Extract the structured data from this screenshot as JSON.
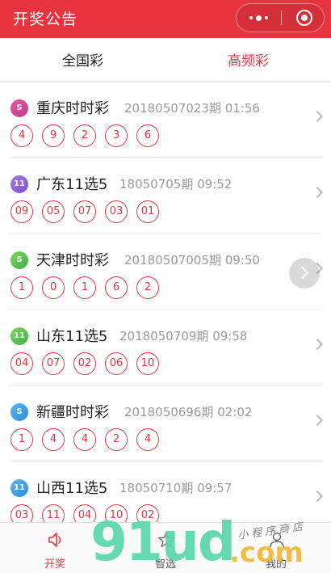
{
  "header": {
    "title": "开奖公告"
  },
  "tabs": [
    {
      "label": "全国彩",
      "active": false
    },
    {
      "label": "高频彩",
      "active": true
    }
  ],
  "lotteries": [
    {
      "name": "重庆时时彩",
      "issue": "20180507023期 01:56",
      "logo_icon": "ssc-logo-icon",
      "logo_text": "S",
      "logo_color": "pink",
      "numbers": [
        "4",
        "9",
        "2",
        "3",
        "6"
      ]
    },
    {
      "name": "广东11选5",
      "issue": "18050705期 09:52",
      "logo_icon": "11x5-logo-icon",
      "logo_text": "11",
      "logo_color": "purple",
      "numbers": [
        "09",
        "05",
        "07",
        "03",
        "01"
      ]
    },
    {
      "name": "天津时时彩",
      "issue": "20180507005期 09:50",
      "logo_icon": "ssc-logo-icon",
      "logo_text": "S",
      "logo_color": "green",
      "numbers": [
        "1",
        "0",
        "1",
        "6",
        "2"
      ]
    },
    {
      "name": "山东11选5",
      "issue": "2018050709期 09:58",
      "logo_icon": "11x5-logo-icon",
      "logo_text": "11",
      "logo_color": "green",
      "numbers": [
        "04",
        "07",
        "02",
        "06",
        "10"
      ]
    },
    {
      "name": "新疆时时彩",
      "issue": "2018050696期 02:02",
      "logo_icon": "ssc-logo-icon",
      "logo_text": "S",
      "logo_color": "blue",
      "numbers": [
        "1",
        "4",
        "4",
        "2",
        "4"
      ]
    },
    {
      "name": "山西11选5",
      "issue": "18050710期 09:57",
      "logo_icon": "11x5-logo-icon",
      "logo_text": "11",
      "logo_color": "blue",
      "numbers": [
        "03",
        "11",
        "04",
        "10",
        "02"
      ]
    }
  ],
  "tabbar": [
    {
      "label": "开奖",
      "icon": "speaker-icon",
      "active": true
    },
    {
      "label": "智选",
      "icon": "star-icon",
      "active": false
    },
    {
      "label": "我的",
      "icon": "person-icon",
      "active": false
    }
  ],
  "watermark": {
    "big": "91ud",
    "com": ".com",
    "small": "小程序商店"
  },
  "colors": {
    "accent": "#e8343f",
    "watermark_green": "#58d6aa",
    "watermark_orange": "#f2b634"
  }
}
